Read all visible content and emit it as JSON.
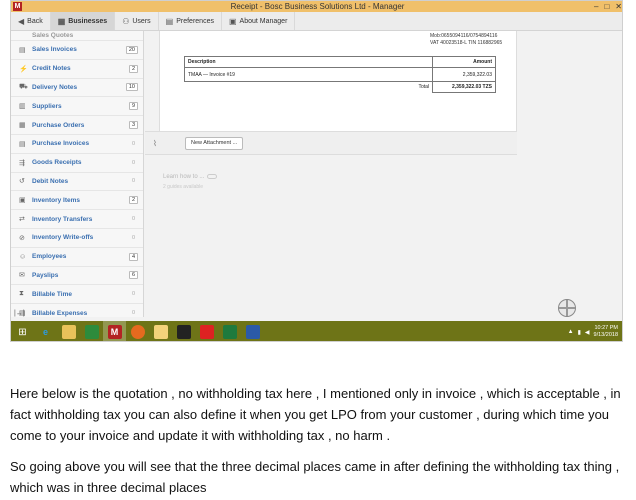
{
  "window": {
    "app_badge": "M",
    "title": "Receipt - Bosc Business Solutions Ltd - Manager",
    "controls": [
      "–",
      "□",
      "✕"
    ]
  },
  "toolbar": {
    "items": [
      {
        "label": "Back",
        "icon": "back-arrow-icon"
      },
      {
        "label": "Businesses",
        "icon": "businesses-icon",
        "active": true
      },
      {
        "label": "Users",
        "icon": "users-icon"
      },
      {
        "label": "Preferences",
        "icon": "preferences-icon"
      },
      {
        "label": "About Manager",
        "icon": "about-icon"
      }
    ]
  },
  "sidebar": {
    "items": [
      {
        "label": "Sales Quotes",
        "count": "",
        "cut": true
      },
      {
        "label": "Sales Invoices",
        "count": "20"
      },
      {
        "label": "Credit Notes",
        "count": "2"
      },
      {
        "label": "Delivery Notes",
        "count": "10"
      },
      {
        "label": "Suppliers",
        "count": "9"
      },
      {
        "label": "Purchase Orders",
        "count": "3"
      },
      {
        "label": "Purchase Invoices",
        "count": "0"
      },
      {
        "label": "Goods Receipts",
        "count": "0"
      },
      {
        "label": "Debit Notes",
        "count": "0"
      },
      {
        "label": "Inventory Items",
        "count": "2"
      },
      {
        "label": "Inventory Transfers",
        "count": "0"
      },
      {
        "label": "Inventory Write-offs",
        "count": "0"
      },
      {
        "label": "Employees",
        "count": "4"
      },
      {
        "label": "Payslips",
        "count": "6"
      },
      {
        "label": "Billable Time",
        "count": "0"
      },
      {
        "label": "Billable Expenses",
        "count": "0"
      }
    ],
    "toggle": "|↔|"
  },
  "receipt": {
    "contact_line1": "Mob:0655094116/0754894116",
    "contact_line2": "VAT 40023518-L TIN 116882965",
    "table": {
      "header_description": "Description",
      "header_amount": "Amount",
      "rows": [
        {
          "description": "TMAA — Invoice #19",
          "amount": "2,359,322.03"
        }
      ],
      "total_label": "Total",
      "total_value": "2,359,322.03 TZS"
    }
  },
  "attachments": {
    "button_label": "New Attachment ..."
  },
  "learn": {
    "title": "Learn how to ...",
    "guides": "2 guides available"
  },
  "taskbar": {
    "clock_time": "10:27 PM",
    "clock_date": "9/13/2018"
  },
  "paragraphs": [
    "Here below is the quotation , no withholding tax here , I mentioned only in invoice , which is acceptable , in fact withholding tax you can also define it when you get LPO from your customer , during which time you come to your invoice and update it with withholding tax , no harm .",
    "So going above you will see that the three decimal places came in after defining the withholding tax thing , which was in three decimal places"
  ],
  "colors": {
    "titlebar": "#f0c06a",
    "taskbar": "#6e7417",
    "link": "#3a6fb0",
    "brand_red": "#b32323"
  }
}
